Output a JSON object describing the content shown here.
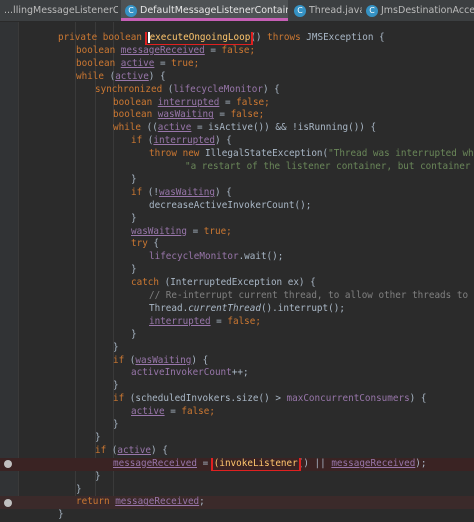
{
  "tabs": [
    {
      "label": "...llingMessageListenerContainer.java",
      "icon": "class-icon",
      "active": false
    },
    {
      "label": "DefaultMessageListenerContainer.java",
      "icon": "class-icon",
      "active": true
    },
    {
      "label": "Thread.java",
      "icon": "class-icon",
      "active": false
    },
    {
      "label": "JmsDestinationAccessor.java",
      "icon": "class-icon",
      "active": false
    }
  ],
  "close_glyph": "×",
  "code": {
    "l1": {
      "kw1": "private ",
      "kw2": "boolean ",
      "method": "executeOngoingLoop",
      "rest1": "() ",
      "kw3": "throws ",
      "rest2": "JMSException {"
    },
    "l2": {
      "kw": "boolean ",
      "field": "messageReceived",
      "rest": " = ",
      "val": "false",
      "end": ";"
    },
    "l3": {
      "kw": "boolean ",
      "field": "active",
      "rest": " = ",
      "val": "true",
      "end": ";"
    },
    "l4": {
      "kw": "while ",
      "rest1": "(",
      "field": "active",
      "rest2": ") {"
    },
    "l5": {
      "kw": "synchronized ",
      "rest1": "(",
      "field": "lifecycleMonitor",
      "rest2": ") {"
    },
    "l6": {
      "kw": "boolean ",
      "field": "interrupted",
      "rest": " = ",
      "val": "false",
      "end": ";"
    },
    "l7": {
      "kw": "boolean ",
      "field": "wasWaiting",
      "rest": " = ",
      "val": "false",
      "end": ";"
    },
    "l8": {
      "kw": "while ",
      "rest1": "((",
      "field": "active",
      "rest2": " = isActive()) && !isRunning()) {"
    },
    "l9": {
      "kw": "if ",
      "rest1": "(",
      "field": "interrupted",
      "rest2": ") {"
    },
    "l10": {
      "kw1": "throw ",
      "kw2": "new ",
      "rest": "IllegalStateException(",
      "str": "\"Thread was interrupted while waiting fo"
    },
    "l11": {
      "str": "\"a restart of the listener container, but container is still st"
    },
    "l12": {
      "text": "}"
    },
    "l13": {
      "kw": "if ",
      "rest1": "(!",
      "field": "wasWaiting",
      "rest2": ") {"
    },
    "l14": {
      "text": "decreaseActiveInvokerCount();"
    },
    "l15": {
      "text": "}"
    },
    "l16": {
      "field": "wasWaiting",
      "rest": " = ",
      "val": "true",
      "end": ";"
    },
    "l17": {
      "kw": "try ",
      "rest": "{"
    },
    "l18": {
      "field": "lifecycleMonitor",
      "rest": ".wait();"
    },
    "l19": {
      "text": "}"
    },
    "l20": {
      "kw": "catch ",
      "rest": "(InterruptedException ex) {"
    },
    "l21": {
      "cmt": "// Re-interrupt current thread, to allow other threads to react."
    },
    "l22": {
      "rest1": "Thread.",
      "ital": "currentThread",
      "rest2": "().interrupt();"
    },
    "l23": {
      "field": "interrupted",
      "rest": " = ",
      "val": "false",
      "end": ";"
    },
    "l24": {
      "text": "}"
    },
    "l25": {
      "text": "}"
    },
    "l26": {
      "kw": "if ",
      "rest1": "(",
      "field": "wasWaiting",
      "rest2": ") {"
    },
    "l27": {
      "field": "activeInvokerCount",
      "rest": "++;"
    },
    "l28": {
      "text": "}"
    },
    "l29": {
      "kw": "if ",
      "rest1": "(scheduledInvokers.size() > ",
      "field": "maxConcurrentConsumers",
      "rest2": ") {"
    },
    "l30": {
      "field": "active",
      "rest": " = ",
      "val": "false",
      "end": ";"
    },
    "l31": {
      "text": "}"
    },
    "l32": {
      "text": "}"
    },
    "l33": {
      "kw": "if ",
      "rest1": "(",
      "field": "active",
      "rest2": ") {"
    },
    "l34": {
      "field": "messageReceived",
      "rest1": " = ",
      "method": "(invokeListener",
      "rest2": "()",
      "rest3": " || ",
      "field2": "messageReceived",
      "end": ");"
    },
    "l35": {
      "text": "}"
    },
    "l36": {
      "text": "}"
    },
    "l37": {
      "kw": "return ",
      "field": "messageReceived",
      "end": ";"
    },
    "l38": {
      "text": "}"
    }
  }
}
